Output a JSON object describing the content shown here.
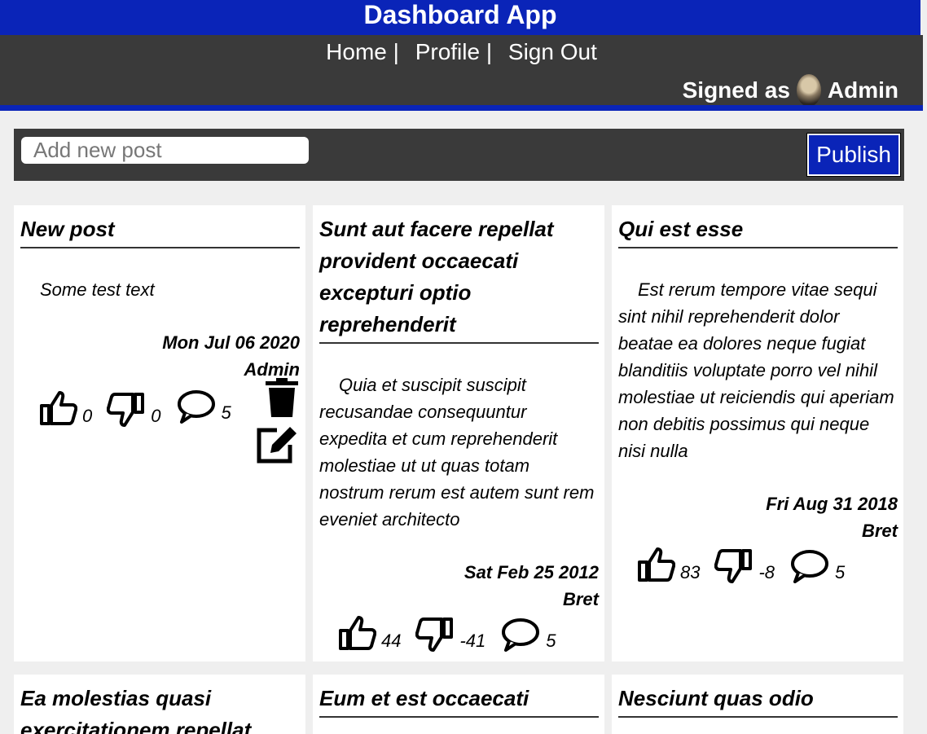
{
  "app": {
    "title": "Dashboard App"
  },
  "nav": {
    "home": "Home |",
    "profile": "Profile |",
    "signout": "Sign Out",
    "signed_prefix": "Signed as",
    "user": "Admin"
  },
  "composer": {
    "placeholder": "Add new post",
    "publish_label": "Publish"
  },
  "posts": [
    {
      "title": "New post",
      "body": "Some test text",
      "date": "Mon Jul 06 2020",
      "author": "Admin",
      "likes": "0",
      "dislikes": "0",
      "comments": "5"
    },
    {
      "title": "Sunt aut facere repellat provident occaecati excepturi optio reprehenderit",
      "body": "Quia et suscipit suscipit recusandae consequuntur expedita et cum reprehenderit molestiae ut ut quas totam nostrum rerum est autem sunt rem eveniet architecto",
      "date": "Sat Feb 25 2012",
      "author": "Bret",
      "likes": "44",
      "dislikes": "-41",
      "comments": "5"
    },
    {
      "title": "Qui est esse",
      "body": "Est rerum tempore vitae sequi sint nihil reprehenderit dolor beatae ea dolores neque fugiat blanditiis voluptate porro vel nihil molestiae ut reiciendis qui aperiam non debitis possimus qui neque nisi nulla",
      "date": "Fri Aug 31 2018",
      "author": "Bret",
      "likes": "83",
      "dislikes": "-8",
      "comments": "5"
    },
    {
      "title": "Ea molestias quasi exercitationem repellat"
    },
    {
      "title": "Eum et est occaecati"
    },
    {
      "title": "Nesciunt quas odio"
    }
  ]
}
